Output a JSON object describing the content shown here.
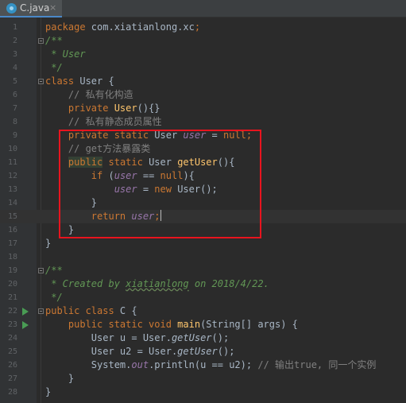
{
  "tab": {
    "filename": "C.java",
    "close_glyph": "×",
    "icon": "java-class-icon"
  },
  "lines": [
    {
      "n": "1",
      "code": [
        [
          "k",
          "package "
        ],
        [
          "p",
          "com.xiatianlong.xc"
        ],
        [
          "k",
          ";"
        ]
      ]
    },
    {
      "n": "2",
      "code": [
        [
          "dc",
          "/**"
        ]
      ],
      "fold": true
    },
    {
      "n": "3",
      "code": [
        [
          "dc",
          " * User"
        ]
      ]
    },
    {
      "n": "4",
      "code": [
        [
          "dc",
          " */"
        ]
      ]
    },
    {
      "n": "5",
      "code": [
        [
          "k",
          "class "
        ],
        [
          "p",
          "User {"
        ]
      ],
      "fold": true
    },
    {
      "n": "6",
      "code": [
        [
          "c",
          "    // 私有化构造"
        ]
      ]
    },
    {
      "n": "7",
      "code": [
        [
          "k",
          "    private "
        ],
        [
          "f",
          "User"
        ],
        [
          "p",
          "(){}"
        ]
      ]
    },
    {
      "n": "8",
      "code": [
        [
          "c",
          "    // 私有静态成员属性"
        ]
      ]
    },
    {
      "n": "9",
      "code": [
        [
          "k",
          "    private static "
        ],
        [
          "p",
          "User "
        ],
        [
          "sf",
          "user"
        ],
        [
          "p",
          " = "
        ],
        [
          "k",
          "null;"
        ]
      ]
    },
    {
      "n": "10",
      "code": [
        [
          "c",
          "    // get方法暴露类"
        ]
      ]
    },
    {
      "n": "11",
      "code": [
        [
          "p",
          "    "
        ],
        [
          "kh",
          "public"
        ],
        [
          "k",
          " static "
        ],
        [
          "p",
          "User "
        ],
        [
          "f",
          "getUser"
        ],
        [
          "p",
          "(){"
        ]
      ]
    },
    {
      "n": "12",
      "code": [
        [
          "k",
          "        if "
        ],
        [
          "p",
          "("
        ],
        [
          "sf",
          "user"
        ],
        [
          "p",
          " == "
        ],
        [
          "k",
          "null"
        ],
        [
          "p",
          "){"
        ]
      ]
    },
    {
      "n": "13",
      "code": [
        [
          "p",
          "            "
        ],
        [
          "sf",
          "user"
        ],
        [
          "p",
          " = "
        ],
        [
          "k",
          "new "
        ],
        [
          "p",
          "User();"
        ]
      ]
    },
    {
      "n": "14",
      "code": [
        [
          "p",
          "        }"
        ]
      ]
    },
    {
      "n": "15",
      "code": [
        [
          "k",
          "        return "
        ],
        [
          "sf",
          "user"
        ],
        [
          "k",
          ";"
        ],
        [
          "caret",
          ""
        ]
      ],
      "current": true
    },
    {
      "n": "16",
      "code": [
        [
          "p",
          "    }"
        ]
      ]
    },
    {
      "n": "17",
      "code": [
        [
          "p",
          "}"
        ]
      ]
    },
    {
      "n": "18",
      "code": [
        [
          "p",
          ""
        ]
      ]
    },
    {
      "n": "19",
      "code": [
        [
          "dc",
          "/**"
        ]
      ],
      "fold": true
    },
    {
      "n": "20",
      "code": [
        [
          "dc",
          " * Created by "
        ],
        [
          "dcs",
          "xiatianlong"
        ],
        [
          "dc",
          " on 2018/4/22."
        ]
      ]
    },
    {
      "n": "21",
      "code": [
        [
          "dc",
          " */"
        ]
      ]
    },
    {
      "n": "22",
      "code": [
        [
          "k",
          "public class "
        ],
        [
          "p",
          "C {"
        ]
      ],
      "run": true,
      "fold": true
    },
    {
      "n": "23",
      "code": [
        [
          "k",
          "    public static void "
        ],
        [
          "f",
          "main"
        ],
        [
          "p",
          "(String[] args) {"
        ]
      ],
      "run": true
    },
    {
      "n": "24",
      "code": [
        [
          "p",
          "        User u = User."
        ],
        [
          "sm",
          "getUser"
        ],
        [
          "p",
          "();"
        ]
      ]
    },
    {
      "n": "25",
      "code": [
        [
          "p",
          "        User u2 = User."
        ],
        [
          "sm",
          "getUser"
        ],
        [
          "p",
          "();"
        ]
      ]
    },
    {
      "n": "26",
      "code": [
        [
          "p",
          "        System."
        ],
        [
          "sf",
          "out"
        ],
        [
          "p",
          ".println(u == u2); "
        ],
        [
          "c",
          "// 输出true, 同一个实例"
        ]
      ]
    },
    {
      "n": "27",
      "code": [
        [
          "p",
          "    }"
        ]
      ]
    },
    {
      "n": "28",
      "code": [
        [
          "p",
          "}"
        ]
      ]
    }
  ],
  "colors": {
    "background": "#2b2b2b",
    "keyword": "#cc7832",
    "comment": "#808080",
    "doc": "#629755",
    "method": "#ffc66d",
    "field": "#9876aa",
    "highlight": "#e8141e"
  }
}
